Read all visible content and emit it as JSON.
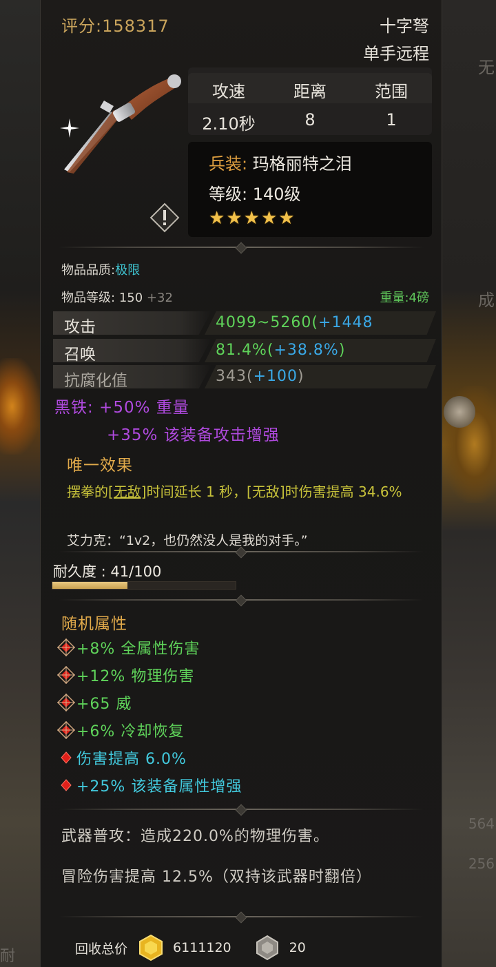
{
  "header": {
    "score": "评分:158317",
    "weapon_type": "十字弩",
    "weapon_subtype": "单手远程"
  },
  "stats_table": {
    "headers": [
      "攻速",
      "距离",
      "范围"
    ],
    "values": [
      "2.10秒",
      "8",
      "1"
    ]
  },
  "info": {
    "set_label": "兵装:",
    "set_name": "玛格丽特之泪",
    "level_label": "等级:",
    "level_value": "140级",
    "stars": 5
  },
  "item": {
    "quality_label": "物品品质:",
    "quality_value": "极限",
    "level_label": "物品等级:",
    "level_value": "150",
    "level_bonus": "+32",
    "weight_label": "重量:",
    "weight_value": "4磅"
  },
  "attributes": [
    {
      "label": "攻击",
      "value": "4099~5260",
      "bonus": "+1448",
      "open": "(",
      "close": ""
    },
    {
      "label": "召唤",
      "value": "81.4%",
      "bonus": "+38.8%",
      "open": "(",
      "close": ")"
    },
    {
      "label": "抗腐化值",
      "value": "343",
      "bonus": "+100",
      "open": "(",
      "close": ")"
    }
  ],
  "material": {
    "line1": "黑铁: +50% 重量",
    "line2": "+35% 该装备攻击增强"
  },
  "unique": {
    "title": "唯一效果",
    "text_pre": "摆拳的",
    "text_link": "[无敌]",
    "text_post": "时间延长 1 秒，[无敌]时伤害提高 34.6%",
    "quote": "艾力克：“1v2，也仍然没人是我的对手。”"
  },
  "durability": {
    "label": "耐久度 : 41/100",
    "current": 41,
    "max": 100
  },
  "random_attrs": {
    "title": "随机属性",
    "items": [
      {
        "text": "+8% 全属性伤害",
        "color": "green",
        "icon": "red-diamond-cross-icon"
      },
      {
        "text": "+12% 物理伤害",
        "color": "green",
        "icon": "red-diamond-cross-icon"
      },
      {
        "text": "+65 威",
        "color": "green",
        "icon": "red-diamond-cross-icon"
      },
      {
        "text": "+6% 冷却恢复",
        "color": "green",
        "icon": "red-diamond-cross-icon"
      },
      {
        "text": "伤害提高 6.0%",
        "color": "cyan",
        "icon": "red-diamond-icon"
      },
      {
        "text": "+25% 该装备属性增强",
        "color": "cyan",
        "icon": "red-diamond-icon"
      }
    ]
  },
  "skills": {
    "normal_attack": "武器普攻：造成220.0%的物理伤害。",
    "adventure": "冒险伤害提高 12.5%（双持该武器时翻倍）"
  },
  "footer": {
    "recycle_label": "回收总价",
    "gold_value": "6111120",
    "stone_value": "20"
  },
  "background": {
    "right_text_1": "无",
    "right_text_2": "成",
    "right_num_1": "564",
    "right_num_2": "256",
    "left_text": "耐"
  },
  "colors": {
    "accent_gold": "#c9a45c",
    "green": "#5fd35a",
    "blue": "#3aa8e6",
    "purple": "#b04adf",
    "cyan": "#42c9dd"
  }
}
